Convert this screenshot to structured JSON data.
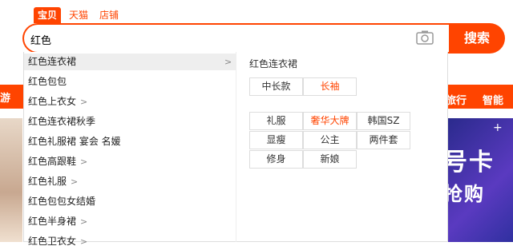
{
  "tabs": [
    {
      "label": "宝贝",
      "active": true
    },
    {
      "label": "天猫"
    },
    {
      "label": "店铺"
    }
  ],
  "search": {
    "value": "红色",
    "button_label": "搜索",
    "camera_icon": "camera-icon"
  },
  "background": {
    "nav_left": "游",
    "nav_right": [
      "旅行",
      "智能生"
    ],
    "banner_line1": "号卡",
    "banner_line2": "抢购",
    "banner_plus": "+"
  },
  "suggestions": [
    {
      "label": "红色连衣裙",
      "arrow": true,
      "active": true
    },
    {
      "label": "红色包包"
    },
    {
      "label": "红色上衣女",
      "arrow": true
    },
    {
      "label": "红色连衣裙秋季"
    },
    {
      "label": "红色礼服裙 宴会 名媛"
    },
    {
      "label": "红色高跟鞋",
      "arrow": true
    },
    {
      "label": "红色礼服",
      "arrow": true
    },
    {
      "label": "红色包包女结婚"
    },
    {
      "label": "红色半身裙",
      "arrow": true
    },
    {
      "label": "红色卫衣女",
      "arrow": true
    }
  ],
  "panel": {
    "title": "红色连衣裙",
    "row1": [
      {
        "label": "中长款"
      },
      {
        "label": "长袖",
        "highlight": true
      }
    ],
    "grid": [
      {
        "label": "礼服"
      },
      {
        "label": "奢华大牌",
        "highlight": true
      },
      {
        "label": "韩国SZ"
      },
      {
        "label": "显瘦"
      },
      {
        "label": "公主"
      },
      {
        "label": "两件套"
      },
      {
        "label": "修身"
      },
      {
        "label": "新娘"
      }
    ]
  },
  "colors": {
    "accent": "#ff4400"
  }
}
